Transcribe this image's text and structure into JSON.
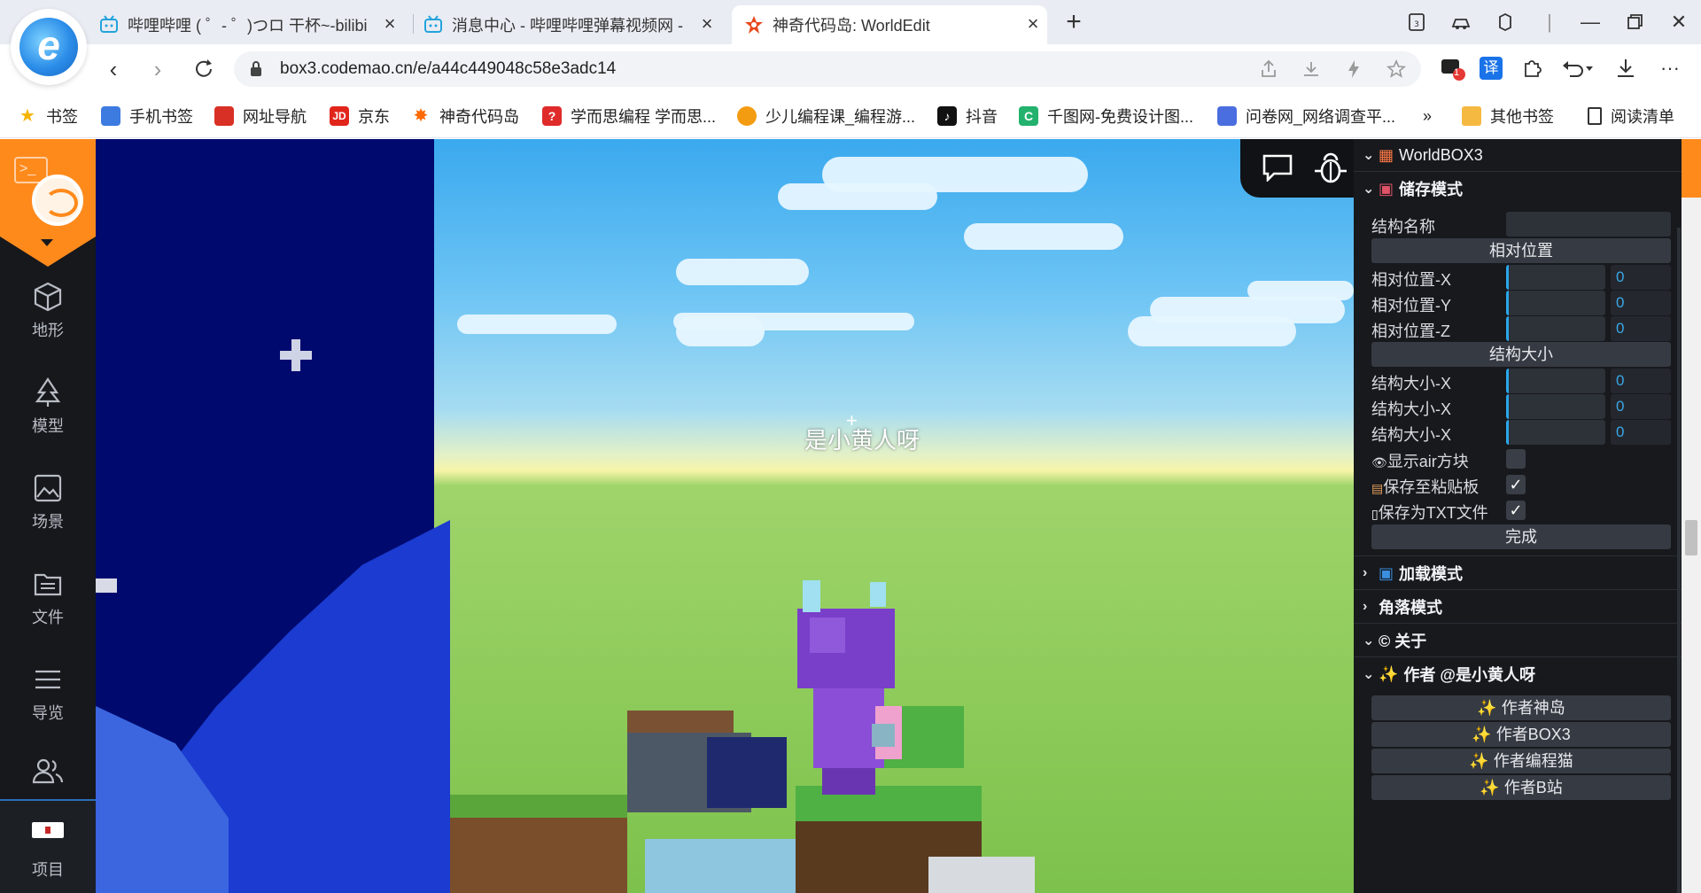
{
  "browser": {
    "tabs": [
      {
        "title": "哔哩哔哩 ( ゜- ゜)つロ 干杯~-bilibili",
        "icon": "bilibili-icon"
      },
      {
        "title": "消息中心 - 哔哩哔哩弹幕视频网 -",
        "icon": "bilibili-icon"
      },
      {
        "title": "神奇代码岛: WorldEdit",
        "icon": "codemao-icon"
      }
    ],
    "new_tab": "+",
    "url": "box3.codemao.cn/e/a44c449048c58e3adc14",
    "window_buttons": [
      "minimize",
      "restore",
      "close"
    ],
    "extension_badge": "1",
    "translate_label": "译",
    "bookmarks": [
      {
        "label": "书签",
        "color": "#f4b400"
      },
      {
        "label": "手机书签",
        "color": "#3d7be0"
      },
      {
        "label": "网址导航",
        "color": "#d93025"
      },
      {
        "label": "京东",
        "color": "#e1251b"
      },
      {
        "label": "神奇代码岛",
        "color": "#ff6a00"
      },
      {
        "label": "学而思编程 学而思...",
        "color": "#e02b2b"
      },
      {
        "label": "少儿编程课_编程游...",
        "color": "#f39c12"
      },
      {
        "label": "抖音",
        "color": "#111111"
      },
      {
        "label": "千图网-免费设计图...",
        "color": "#23b26d"
      },
      {
        "label": "问卷网_网络调查平...",
        "color": "#4a6ee0"
      }
    ],
    "bookmarks_more": "»",
    "other_bookmarks": "其他书签",
    "reading_list": "阅读清单"
  },
  "sidebar": {
    "items": [
      {
        "label": "地形",
        "icon": "cube-icon"
      },
      {
        "label": "模型",
        "icon": "tree-icon"
      },
      {
        "label": "场景",
        "icon": "image-icon"
      },
      {
        "label": "文件",
        "icon": "folder-icon"
      },
      {
        "label": "导览",
        "icon": "list-icon"
      },
      {
        "label": "",
        "icon": "users-icon"
      }
    ],
    "project_label": "项目"
  },
  "scene": {
    "player_name": "是小黄人呀"
  },
  "panel": {
    "title": "WorldBOX3",
    "save_mode": "储存模式",
    "struct_name_label": "结构名称",
    "rel_pos_button": "相对位置",
    "rel_x": "相对位置-X",
    "rel_y": "相对位置-Y",
    "rel_z": "相对位置-Z",
    "struct_size_button": "结构大小",
    "size_x1": "结构大小-X",
    "size_x2": "结构大小-X",
    "size_x3": "结构大小-X",
    "value_zero": "0",
    "show_air": "显示air方块",
    "save_clipboard": "保存至粘贴板",
    "save_txt": "保存为TXT文件",
    "done": "完成",
    "load_mode": "加载模式",
    "corner_mode": "角落模式",
    "about": "© 关于",
    "author_header": "作者 @是小黄人呀",
    "author_links": [
      "作者神岛",
      "作者BOX3",
      "作者编程猫",
      "作者B站"
    ],
    "checkmark": "✓"
  }
}
